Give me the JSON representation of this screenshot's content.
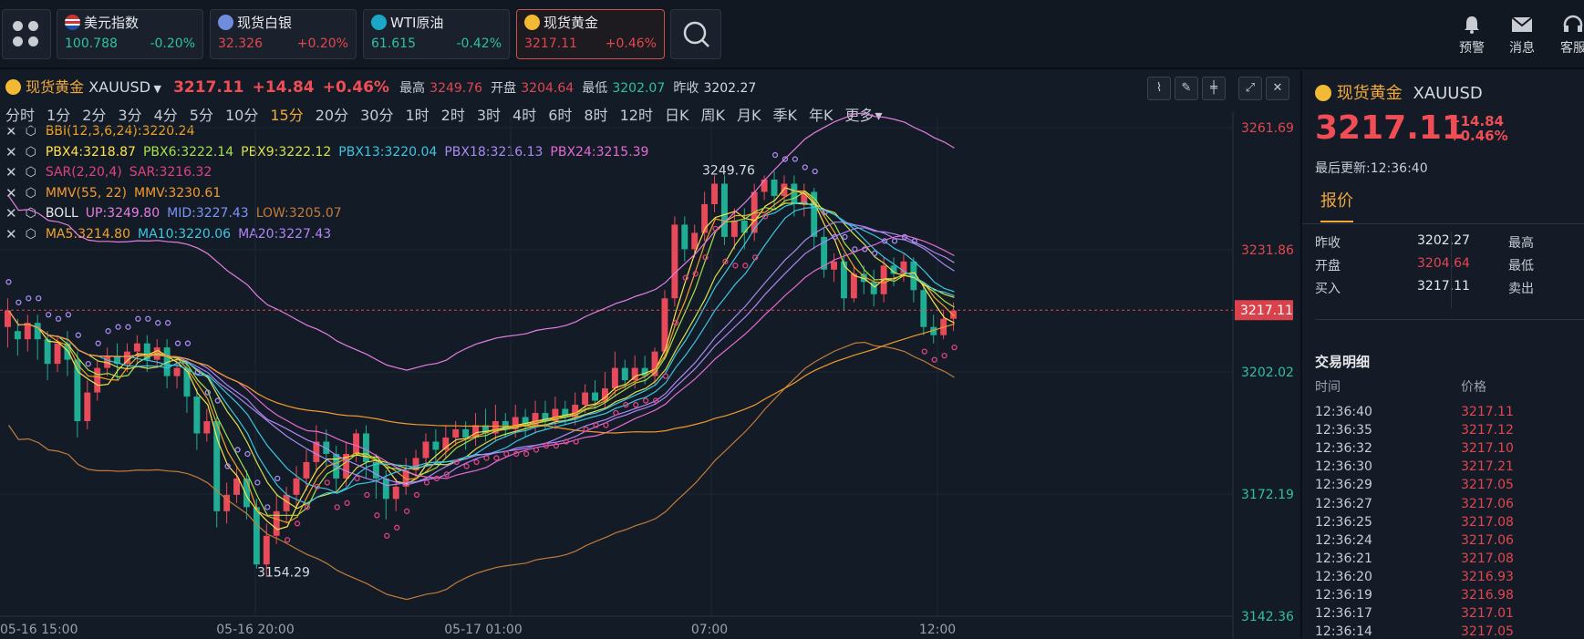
{
  "quotes": [
    {
      "name": "美元指数",
      "price": "100.788",
      "change": "-0.20%",
      "flag": "us-flag-icon"
    },
    {
      "name": "现货白银",
      "price": "32.326",
      "change": "+0.20%",
      "flag": "silver-icon"
    },
    {
      "name": "WTI原油",
      "price": "61.615",
      "change": "-0.42%",
      "flag": "oil-icon"
    },
    {
      "name": "现货黄金",
      "price": "3217.11",
      "change": "+0.46%",
      "flag": "gold-icon"
    }
  ],
  "tools": {
    "alert": "预警",
    "message": "消息",
    "service": "客服"
  },
  "header": {
    "name": "现货黄金",
    "code": "XAUUSD",
    "price": "3217.11",
    "change": "+14.84",
    "pct": "+0.46%",
    "high_label": "最高",
    "high": "3249.76",
    "open_label": "开盘",
    "open": "3204.64",
    "low_label": "最低",
    "low": "3202.07",
    "prev_label": "昨收",
    "prev": "3202.27"
  },
  "periods": [
    "分时",
    "1分",
    "2分",
    "3分",
    "4分",
    "5分",
    "10分",
    "15分",
    "20分",
    "30分",
    "1时",
    "2时",
    "3时",
    "4时",
    "6时",
    "8时",
    "12时",
    "日K",
    "周K",
    "月K",
    "季K",
    "年K",
    "更多"
  ],
  "active_period": "15分",
  "indicators": [
    {
      "items": [
        {
          "t": "BBI(12,3,6,24):3220.24",
          "c": "#f4a21e"
        }
      ]
    },
    {
      "items": [
        {
          "t": "PBX4:3218.87",
          "c": "#ffe24a"
        },
        {
          "t": "PBX6:3222.14",
          "c": "#a6e04a"
        },
        {
          "t": "PBX9:3222.12",
          "c": "#d8e04a"
        },
        {
          "t": "PBX13:3220.04",
          "c": "#3cc6e0"
        },
        {
          "t": "PBX18:3216.13",
          "c": "#a98af0"
        },
        {
          "t": "PBX24:3215.39",
          "c": "#e56ad1"
        }
      ]
    },
    {
      "items": [
        {
          "t": "SAR(2,20,4)",
          "c": "#e0427e"
        },
        {
          "t": "SAR:3216.32",
          "c": "#e0427e"
        }
      ]
    },
    {
      "items": [
        {
          "t": "MMV(55, 22)",
          "c": "#f39a2c"
        },
        {
          "t": "MMV:3230.61",
          "c": "#f39a2c"
        }
      ]
    },
    {
      "items": [
        {
          "t": "BOLL",
          "c": "#e6e8ec"
        },
        {
          "t": "UP:3249.80",
          "c": "#e47ee0"
        },
        {
          "t": "MID:3227.43",
          "c": "#7c94f2"
        },
        {
          "t": "LOW:3205.07",
          "c": "#c27a3a"
        }
      ]
    },
    {
      "items": [
        {
          "t": "MA5:3214.80",
          "c": "#f0a32a"
        },
        {
          "t": "MA10:3220.06",
          "c": "#3cc6e0"
        },
        {
          "t": "MA20:3227.43",
          "c": "#b184f5"
        }
      ]
    }
  ],
  "chart_data": {
    "type": "candlestick",
    "y_ticks": [
      "3261.69",
      "3231.86",
      "3202.02",
      "3172.19",
      "3142.36"
    ],
    "x_ticks": [
      "05-16 15:00",
      "05-16 20:00",
      "05-17 01:00",
      "07:00",
      "12:00"
    ],
    "current_price_label": "3217.11",
    "high_annotation": "3249.76",
    "low_annotation": "3154.29",
    "ylim": [
      3142.36,
      3261.69
    ],
    "candles": [
      [
        3213,
        3217,
        3208,
        3220
      ],
      [
        3212,
        3210,
        3206,
        3215
      ],
      [
        3210,
        3214,
        3207,
        3216
      ],
      [
        3214,
        3210,
        3205,
        3216
      ],
      [
        3210,
        3204,
        3200,
        3212
      ],
      [
        3204,
        3209,
        3202,
        3211
      ],
      [
        3209,
        3205,
        3201,
        3212
      ],
      [
        3205,
        3190,
        3186,
        3207
      ],
      [
        3190,
        3197,
        3188,
        3200
      ],
      [
        3197,
        3203,
        3195,
        3205
      ],
      [
        3203,
        3206,
        3201,
        3208
      ],
      [
        3206,
        3204,
        3200,
        3209
      ],
      [
        3204,
        3207,
        3202,
        3209
      ],
      [
        3207,
        3209,
        3204,
        3211
      ],
      [
        3209,
        3205,
        3202,
        3211
      ],
      [
        3205,
        3208,
        3203,
        3210
      ],
      [
        3208,
        3201,
        3198,
        3210
      ],
      [
        3201,
        3203,
        3198,
        3205
      ],
      [
        3203,
        3196,
        3192,
        3205
      ],
      [
        3196,
        3187,
        3183,
        3198
      ],
      [
        3187,
        3190,
        3185,
        3193
      ],
      [
        3190,
        3168,
        3164,
        3191
      ],
      [
        3168,
        3172,
        3165,
        3175
      ],
      [
        3172,
        3176,
        3170,
        3179
      ],
      [
        3176,
        3169,
        3166,
        3178
      ],
      [
        3169,
        3155,
        3154,
        3171
      ],
      [
        3155,
        3162,
        3152,
        3165
      ],
      [
        3162,
        3168,
        3160,
        3172
      ],
      [
        3168,
        3172,
        3165,
        3174
      ],
      [
        3172,
        3176,
        3169,
        3179
      ],
      [
        3176,
        3180,
        3173,
        3183
      ],
      [
        3180,
        3185,
        3178,
        3189
      ],
      [
        3185,
        3182,
        3179,
        3188
      ],
      [
        3182,
        3176,
        3173,
        3184
      ],
      [
        3176,
        3182,
        3174,
        3185
      ],
      [
        3182,
        3187,
        3180,
        3188
      ],
      [
        3187,
        3180,
        3176,
        3189
      ],
      [
        3180,
        3176,
        3171,
        3182
      ],
      [
        3176,
        3171,
        3166,
        3178
      ],
      [
        3171,
        3174,
        3168,
        3176
      ],
      [
        3174,
        3178,
        3172,
        3181
      ],
      [
        3178,
        3181,
        3176,
        3183
      ],
      [
        3181,
        3185,
        3179,
        3187
      ],
      [
        3185,
        3183,
        3180,
        3188
      ],
      [
        3183,
        3186,
        3181,
        3189
      ],
      [
        3186,
        3188,
        3184,
        3190
      ],
      [
        3188,
        3186,
        3183,
        3190
      ],
      [
        3186,
        3189,
        3184,
        3192
      ],
      [
        3189,
        3187,
        3185,
        3193
      ],
      [
        3187,
        3190,
        3185,
        3194
      ],
      [
        3190,
        3188,
        3186,
        3192
      ],
      [
        3188,
        3191,
        3186,
        3194
      ],
      [
        3191,
        3189,
        3186,
        3193
      ],
      [
        3189,
        3192,
        3187,
        3195
      ],
      [
        3192,
        3190,
        3188,
        3195
      ],
      [
        3190,
        3193,
        3188,
        3196
      ],
      [
        3193,
        3191,
        3189,
        3195
      ],
      [
        3191,
        3194,
        3189,
        3197
      ],
      [
        3194,
        3197,
        3192,
        3199
      ],
      [
        3197,
        3195,
        3193,
        3200
      ],
      [
        3195,
        3198,
        3193,
        3202
      ],
      [
        3198,
        3203,
        3196,
        3207
      ],
      [
        3203,
        3200,
        3198,
        3205
      ],
      [
        3200,
        3203,
        3198,
        3206
      ],
      [
        3203,
        3201,
        3199,
        3206
      ],
      [
        3201,
        3207,
        3199,
        3208
      ],
      [
        3207,
        3220,
        3205,
        3222
      ],
      [
        3220,
        3238,
        3218,
        3240
      ],
      [
        3238,
        3232,
        3229,
        3240
      ],
      [
        3232,
        3236,
        3230,
        3238
      ],
      [
        3236,
        3243,
        3234,
        3246
      ],
      [
        3243,
        3248,
        3241,
        3250
      ],
      [
        3248,
        3235,
        3233,
        3250
      ],
      [
        3235,
        3239,
        3232,
        3242
      ],
      [
        3239,
        3236,
        3232,
        3242
      ],
      [
        3236,
        3246,
        3234,
        3248
      ],
      [
        3246,
        3249,
        3244,
        3250
      ],
      [
        3249,
        3245,
        3242,
        3251
      ],
      [
        3245,
        3248,
        3243,
        3250
      ],
      [
        3248,
        3243,
        3240,
        3250
      ],
      [
        3243,
        3246,
        3240,
        3248
      ],
      [
        3246,
        3235,
        3232,
        3247
      ],
      [
        3235,
        3227,
        3225,
        3237
      ],
      [
        3227,
        3229,
        3224,
        3231
      ],
      [
        3229,
        3220,
        3217,
        3231
      ],
      [
        3220,
        3226,
        3219,
        3228
      ],
      [
        3226,
        3224,
        3221,
        3228
      ],
      [
        3224,
        3221,
        3218,
        3227
      ],
      [
        3221,
        3228,
        3219,
        3230
      ],
      [
        3228,
        3226,
        3223,
        3230
      ],
      [
        3226,
        3229,
        3224,
        3231
      ],
      [
        3229,
        3222,
        3219,
        3230
      ],
      [
        3222,
        3213,
        3211,
        3224
      ],
      [
        3213,
        3211,
        3209,
        3216
      ],
      [
        3211,
        3215,
        3210,
        3217
      ],
      [
        3215,
        3217,
        3212,
        3219
      ]
    ]
  },
  "panel": {
    "name": "现货黄金",
    "code": "XAUUSD",
    "price": "3217.11",
    "change": "+14.84",
    "pct": "+0.46%",
    "update_label": "最后更新:",
    "update_time": "12:36:40",
    "tab": "报价",
    "rows": [
      {
        "l": "昨收",
        "v": "3202.27",
        "l2": "最高"
      },
      {
        "l": "开盘",
        "v": "3204.64",
        "l2": "最低"
      },
      {
        "l": "买入",
        "v": "3217.11",
        "l2": "卖出"
      }
    ],
    "trades_title": "交易明细",
    "col_time": "时间",
    "col_price": "价格",
    "trades": [
      {
        "t": "12:36:40",
        "p": "3217.11"
      },
      {
        "t": "12:36:35",
        "p": "3217.12"
      },
      {
        "t": "12:36:32",
        "p": "3217.10"
      },
      {
        "t": "12:36:30",
        "p": "3217.21"
      },
      {
        "t": "12:36:29",
        "p": "3217.05"
      },
      {
        "t": "12:36:27",
        "p": "3217.06"
      },
      {
        "t": "12:36:25",
        "p": "3217.08"
      },
      {
        "t": "12:36:24",
        "p": "3217.06"
      },
      {
        "t": "12:36:21",
        "p": "3217.08"
      },
      {
        "t": "12:36:20",
        "p": "3216.93"
      },
      {
        "t": "12:36:19",
        "p": "3216.98"
      },
      {
        "t": "12:36:17",
        "p": "3217.01"
      },
      {
        "t": "12:36:14",
        "p": "3217.05"
      }
    ]
  }
}
